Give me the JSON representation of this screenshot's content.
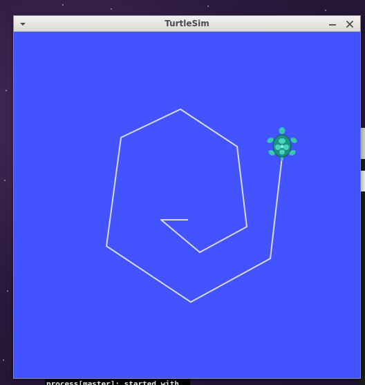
{
  "window": {
    "title": "TurtleSim"
  },
  "canvas": {
    "background_color": "#4253ff",
    "pen_color": "#d8daf0"
  },
  "turtle": {
    "icon": "turtle-icon",
    "shell_color": "#2fb8a8"
  },
  "background": {
    "terminal_line": "process[master]: started with"
  },
  "icons": {
    "menu": "chevron-down-icon",
    "minimize": "minimize-icon",
    "close": "close-icon"
  }
}
